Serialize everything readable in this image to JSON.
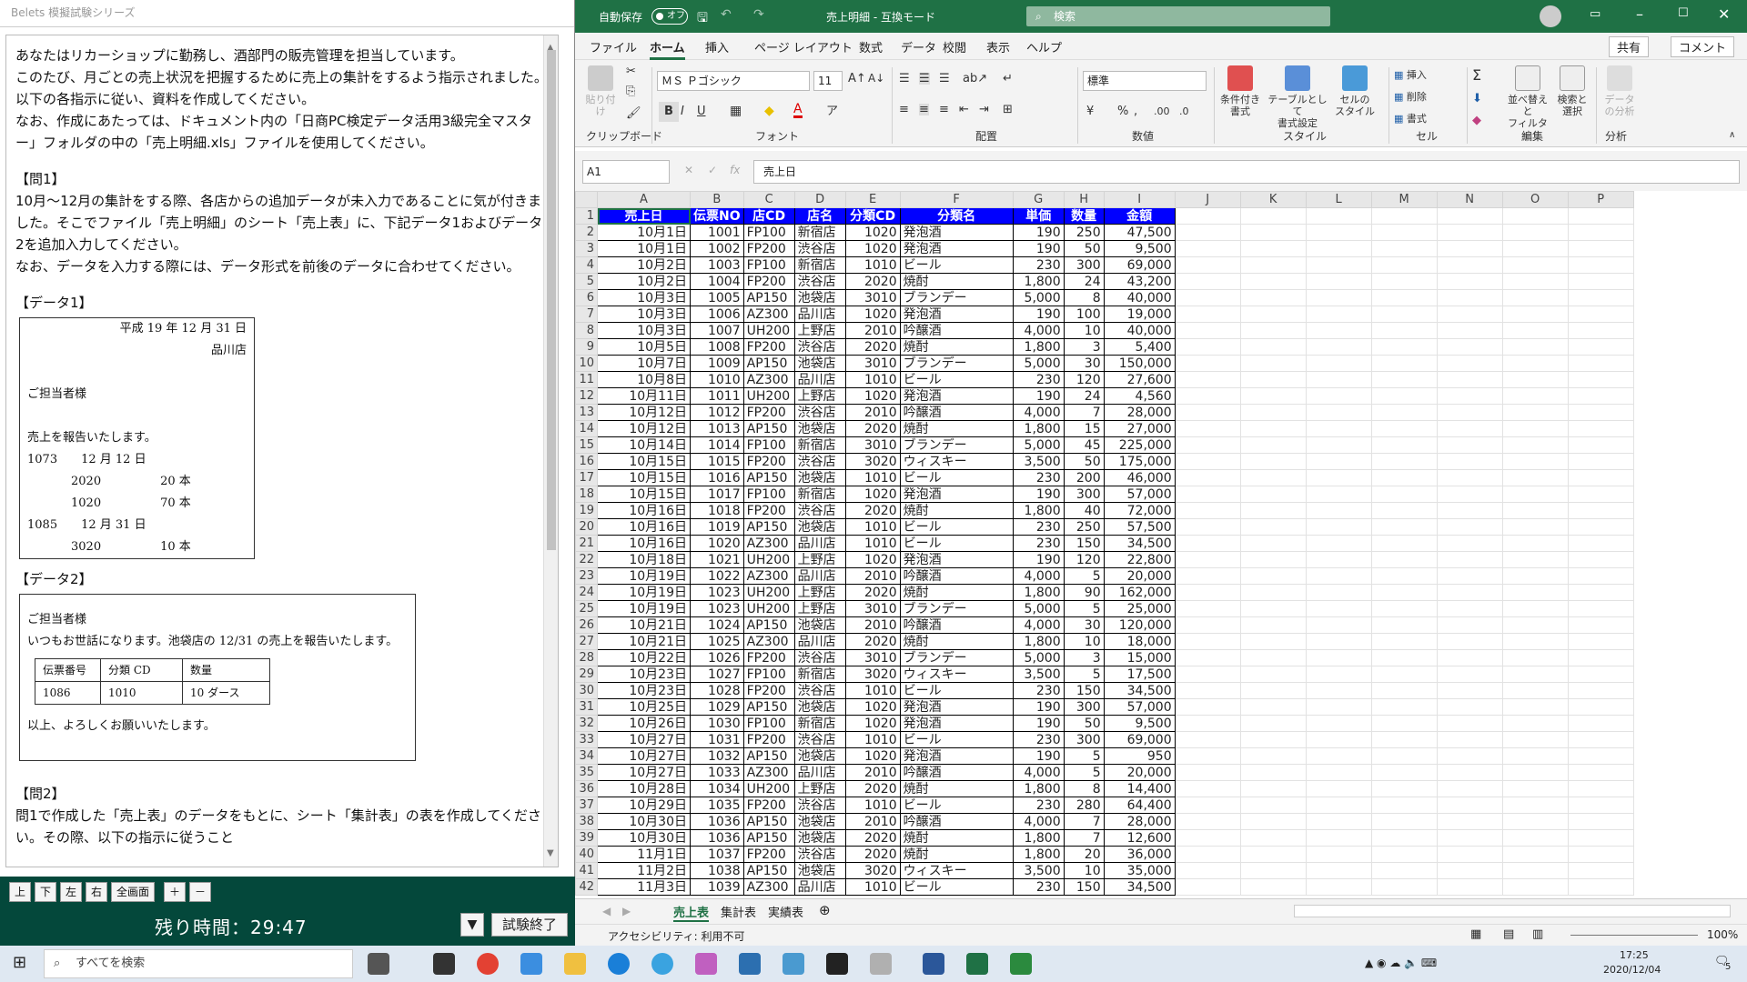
{
  "left": {
    "title": "Belets 模擬試験シリーズ",
    "paragraphs": [
      "あなたはリカーショップに勤務し、酒部門の販売管理を担当しています。\nこのたび、月ごとの売上状況を把握するために売上の集計をするよう指示されました。\n以下の各指示に従い、資料を作成してください。\nなお、作成にあたっては、ドキュメント内の「日商PC検定データ活用3級完全マスター」フォルダの中の「売上明細.xls」ファイルを使用してください。",
      "【問1】\n10月～12月の集計をする際、各店からの追加データが未入力であることに気が付きました。そこでファイル「売上明細」のシート「売上表」に、下記データ1およびデータ2を追加入力してください。\nなお、データを入力する際には、データ形式を前後のデータに合わせてください。",
      "【データ1】"
    ],
    "memo1": [
      "平成 19 年 12 月 31 日",
      "品川店",
      "ご担当者様",
      "売上を報告いたします。",
      "1073　　12 月 12 日",
      "2020　　　　　20 本",
      "1020　　　　　70 本",
      "1085　　12 月 31 日",
      "3020　　　　　10 本"
    ],
    "data2_label": "【データ2】",
    "memo2": {
      "greet": "ご担当者様",
      "msg": "いつもお世話になります。池袋店の 12/31 の売上を報告いたします。",
      "headers": [
        "伝票番号",
        "分類 CD",
        "数量"
      ],
      "row": [
        "1086",
        "1010",
        "10 ダース"
      ],
      "close": "以上、よろしくお願いいたします。"
    },
    "q2": "【問2】\n問1で作成した「売上表」のデータをもとに、シート「集計表」の表を作成してください。その際、以下の指示に従うこと",
    "buttons": [
      "上",
      "下",
      "左",
      "右",
      "全画面",
      "＋",
      "－"
    ],
    "timer": "残り時間：29:47",
    "end_button": "試験終了",
    "dropdown": "▼"
  },
  "excel": {
    "autosave": "自動保存",
    "autosave_state": "オフ",
    "file_title": "売上明細 - 互換モード",
    "search_placeholder": "検索",
    "tabs": [
      "ファイル",
      "ホーム",
      "挿入",
      "ページ レイアウト",
      "数式",
      "データ",
      "校閲",
      "表示",
      "ヘルプ"
    ],
    "active_tab": "ホーム",
    "share": "共有",
    "comment": "コメント",
    "groups": [
      "クリップボード",
      "フォント",
      "配置",
      "数値",
      "スタイル",
      "セル",
      "編集",
      "分析"
    ],
    "paste": "貼り付け",
    "font_name": "ＭＳ Ｐゴシック",
    "font_size": "11",
    "number_format": "標準",
    "style_buttons": [
      "条件付き\n書式",
      "テーブルとして\n書式設定",
      "セルの\nスタイル"
    ],
    "cell_buttons": [
      "挿入",
      "削除",
      "書式"
    ],
    "edit_buttons": [
      "並べ替えと\nフィルター",
      "検索と\n選択"
    ],
    "analysis_button": "データ\nの分析",
    "name_box": "A1",
    "formula": "売上日",
    "col_letters": [
      "A",
      "B",
      "C",
      "D",
      "E",
      "F",
      "G",
      "H",
      "I",
      "J",
      "K",
      "L",
      "M",
      "N",
      "O",
      "P"
    ],
    "headers": [
      "売上日",
      "伝票NO",
      "店CD",
      "店名",
      "分類CD",
      "分類名",
      "単価",
      "数量",
      "金額"
    ],
    "rows": [
      [
        "10月1日",
        "1001",
        "FP100",
        "新宿店",
        "1020",
        "発泡酒",
        "190",
        "250",
        "47,500"
      ],
      [
        "10月1日",
        "1002",
        "FP200",
        "渋谷店",
        "1020",
        "発泡酒",
        "190",
        "50",
        "9,500"
      ],
      [
        "10月2日",
        "1003",
        "FP100",
        "新宿店",
        "1010",
        "ビール",
        "230",
        "300",
        "69,000"
      ],
      [
        "10月2日",
        "1004",
        "FP200",
        "渋谷店",
        "2020",
        "焼酎",
        "1,800",
        "24",
        "43,200"
      ],
      [
        "10月3日",
        "1005",
        "AP150",
        "池袋店",
        "3010",
        "ブランデー",
        "5,000",
        "8",
        "40,000"
      ],
      [
        "10月3日",
        "1006",
        "AZ300",
        "品川店",
        "1020",
        "発泡酒",
        "190",
        "100",
        "19,000"
      ],
      [
        "10月3日",
        "1007",
        "UH200",
        "上野店",
        "2010",
        "吟醸酒",
        "4,000",
        "10",
        "40,000"
      ],
      [
        "10月5日",
        "1008",
        "FP200",
        "渋谷店",
        "2020",
        "焼酎",
        "1,800",
        "3",
        "5,400"
      ],
      [
        "10月7日",
        "1009",
        "AP150",
        "池袋店",
        "3010",
        "ブランデー",
        "5,000",
        "30",
        "150,000"
      ],
      [
        "10月8日",
        "1010",
        "AZ300",
        "品川店",
        "1010",
        "ビール",
        "230",
        "120",
        "27,600"
      ],
      [
        "10月11日",
        "1011",
        "UH200",
        "上野店",
        "1020",
        "発泡酒",
        "190",
        "24",
        "4,560"
      ],
      [
        "10月12日",
        "1012",
        "FP200",
        "渋谷店",
        "2010",
        "吟醸酒",
        "4,000",
        "7",
        "28,000"
      ],
      [
        "10月12日",
        "1013",
        "AP150",
        "池袋店",
        "2020",
        "焼酎",
        "1,800",
        "15",
        "27,000"
      ],
      [
        "10月14日",
        "1014",
        "FP100",
        "新宿店",
        "3010",
        "ブランデー",
        "5,000",
        "45",
        "225,000"
      ],
      [
        "10月15日",
        "1015",
        "FP200",
        "渋谷店",
        "3020",
        "ウィスキー",
        "3,500",
        "50",
        "175,000"
      ],
      [
        "10月15日",
        "1016",
        "AP150",
        "池袋店",
        "1010",
        "ビール",
        "230",
        "200",
        "46,000"
      ],
      [
        "10月15日",
        "1017",
        "FP100",
        "新宿店",
        "1020",
        "発泡酒",
        "190",
        "300",
        "57,000"
      ],
      [
        "10月16日",
        "1018",
        "FP200",
        "渋谷店",
        "2020",
        "焼酎",
        "1,800",
        "40",
        "72,000"
      ],
      [
        "10月16日",
        "1019",
        "AP150",
        "池袋店",
        "1010",
        "ビール",
        "230",
        "250",
        "57,500"
      ],
      [
        "10月16日",
        "1020",
        "AZ300",
        "品川店",
        "1010",
        "ビール",
        "230",
        "150",
        "34,500"
      ],
      [
        "10月18日",
        "1021",
        "UH200",
        "上野店",
        "1020",
        "発泡酒",
        "190",
        "120",
        "22,800"
      ],
      [
        "10月19日",
        "1022",
        "AZ300",
        "品川店",
        "2010",
        "吟醸酒",
        "4,000",
        "5",
        "20,000"
      ],
      [
        "10月19日",
        "1023",
        "UH200",
        "上野店",
        "2020",
        "焼酎",
        "1,800",
        "90",
        "162,000"
      ],
      [
        "10月19日",
        "1023",
        "UH200",
        "上野店",
        "3010",
        "ブランデー",
        "5,000",
        "5",
        "25,000"
      ],
      [
        "10月21日",
        "1024",
        "AP150",
        "池袋店",
        "2010",
        "吟醸酒",
        "4,000",
        "30",
        "120,000"
      ],
      [
        "10月21日",
        "1025",
        "AZ300",
        "品川店",
        "2020",
        "焼酎",
        "1,800",
        "10",
        "18,000"
      ],
      [
        "10月22日",
        "1026",
        "FP200",
        "渋谷店",
        "3010",
        "ブランデー",
        "5,000",
        "3",
        "15,000"
      ],
      [
        "10月23日",
        "1027",
        "FP100",
        "新宿店",
        "3020",
        "ウィスキー",
        "3,500",
        "5",
        "17,500"
      ],
      [
        "10月23日",
        "1028",
        "FP200",
        "渋谷店",
        "1010",
        "ビール",
        "230",
        "150",
        "34,500"
      ],
      [
        "10月25日",
        "1029",
        "AP150",
        "池袋店",
        "1020",
        "発泡酒",
        "190",
        "300",
        "57,000"
      ],
      [
        "10月26日",
        "1030",
        "FP100",
        "新宿店",
        "1020",
        "発泡酒",
        "190",
        "50",
        "9,500"
      ],
      [
        "10月27日",
        "1031",
        "FP200",
        "渋谷店",
        "1010",
        "ビール",
        "230",
        "300",
        "69,000"
      ],
      [
        "10月27日",
        "1032",
        "AP150",
        "池袋店",
        "1020",
        "発泡酒",
        "190",
        "5",
        "950"
      ],
      [
        "10月27日",
        "1033",
        "AZ300",
        "品川店",
        "2010",
        "吟醸酒",
        "4,000",
        "5",
        "20,000"
      ],
      [
        "10月28日",
        "1034",
        "UH200",
        "上野店",
        "2020",
        "焼酎",
        "1,800",
        "8",
        "14,400"
      ],
      [
        "10月29日",
        "1035",
        "FP200",
        "渋谷店",
        "1010",
        "ビール",
        "230",
        "280",
        "64,400"
      ],
      [
        "10月30日",
        "1036",
        "AP150",
        "池袋店",
        "2010",
        "吟醸酒",
        "4,000",
        "7",
        "28,000"
      ],
      [
        "10月30日",
        "1036",
        "AP150",
        "池袋店",
        "2020",
        "焼酎",
        "1,800",
        "7",
        "12,600"
      ],
      [
        "11月1日",
        "1037",
        "FP200",
        "渋谷店",
        "2020",
        "焼酎",
        "1,800",
        "20",
        "36,000"
      ],
      [
        "11月2日",
        "1038",
        "AP150",
        "池袋店",
        "3020",
        "ウィスキー",
        "3,500",
        "10",
        "35,000"
      ],
      [
        "11月3日",
        "1039",
        "AZ300",
        "品川店",
        "1010",
        "ビール",
        "230",
        "150",
        "34,500"
      ]
    ],
    "sheet_tabs": [
      "売上表",
      "集計表",
      "実績表"
    ],
    "active_sheet": "売上表",
    "status_text": "アクセシビリティ: 利用不可",
    "zoom": "100%"
  },
  "taskbar": {
    "search": "すべてを検索",
    "time": "17:25",
    "date": "2020/12/04",
    "notif": "5"
  },
  "colors": {
    "excel_green": "#1f7145",
    "header_fill": "#0000ff",
    "exam_bar": "#04483b"
  }
}
